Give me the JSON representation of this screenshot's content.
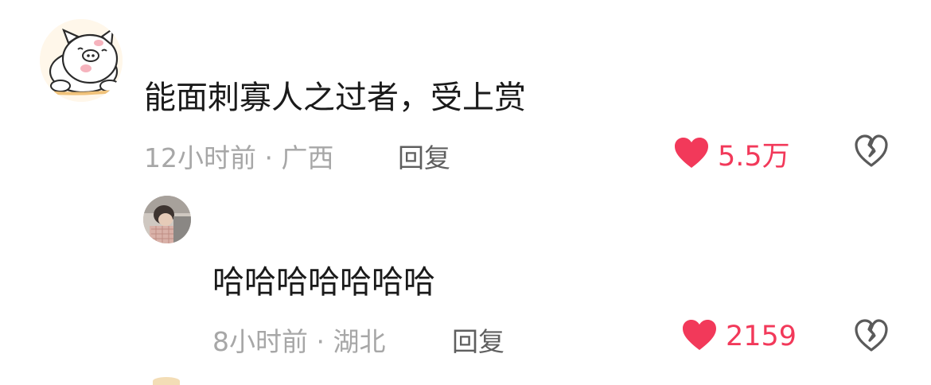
{
  "comments": [
    {
      "text": "能面刺寡人之过者，受上赏",
      "time": "12小时前",
      "location": "广西",
      "reply_label": "回复",
      "like_count": "5.5万"
    },
    {
      "text": "哈哈哈哈哈哈哈",
      "time": "8小时前",
      "location": "湖北",
      "reply_label": "回复",
      "like_count": "2159"
    }
  ],
  "separator": "·",
  "icons": {
    "like": "heart-icon",
    "dislike": "broken-heart-icon"
  },
  "colors": {
    "like_red": "#f2395a",
    "meta_gray": "#a7a7a7",
    "reply_gray": "#5f5f5f"
  }
}
